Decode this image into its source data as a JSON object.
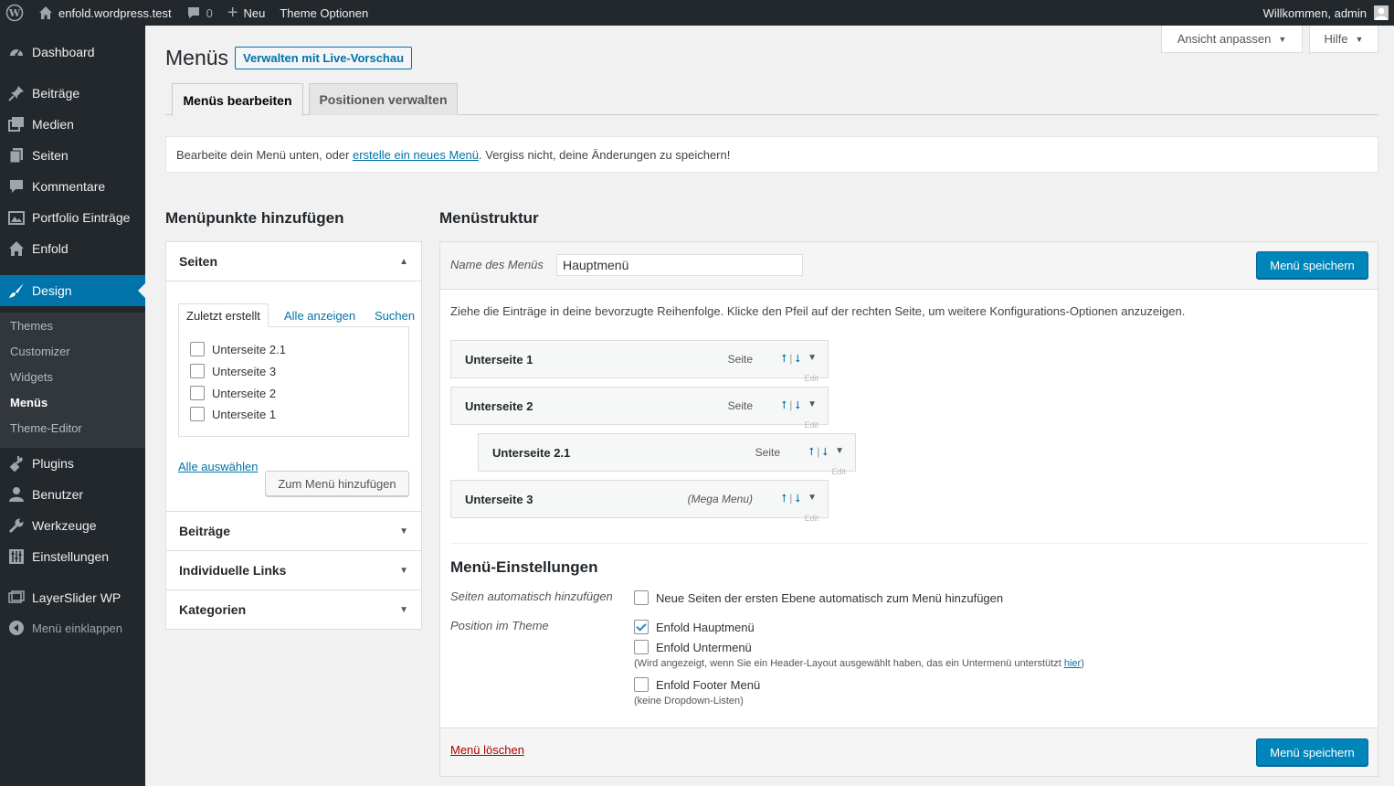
{
  "adminbar": {
    "site_name": "enfold.wordpress.test",
    "comments_count": "0",
    "new_label": "Neu",
    "theme_options": "Theme Optionen",
    "welcome": "Willkommen, admin"
  },
  "sidebar": {
    "items": [
      {
        "label": "Dashboard",
        "icon": "dashboard-icon"
      },
      {
        "label": "Beiträge",
        "icon": "pin-icon"
      },
      {
        "label": "Medien",
        "icon": "media-icon"
      },
      {
        "label": "Seiten",
        "icon": "pages-icon"
      },
      {
        "label": "Kommentare",
        "icon": "comment-icon"
      },
      {
        "label": "Portfolio Einträge",
        "icon": "portfolio-icon"
      },
      {
        "label": "Enfold",
        "icon": "home-icon"
      },
      {
        "label": "Design",
        "icon": "brush-icon"
      },
      {
        "label": "Plugins",
        "icon": "plugin-icon"
      },
      {
        "label": "Benutzer",
        "icon": "user-icon"
      },
      {
        "label": "Werkzeuge",
        "icon": "wrench-icon"
      },
      {
        "label": "Einstellungen",
        "icon": "settings-icon"
      },
      {
        "label": "LayerSlider WP",
        "icon": "layerslider-icon"
      },
      {
        "label": "Menü einklappen",
        "icon": "collapse-icon"
      }
    ],
    "submenu": [
      "Themes",
      "Customizer",
      "Widgets",
      "Menüs",
      "Theme-Editor"
    ]
  },
  "screen_meta": {
    "options": "Ansicht anpassen",
    "help": "Hilfe"
  },
  "header": {
    "title": "Menüs",
    "live_preview": "Verwalten mit Live-Vorschau"
  },
  "tabs": [
    "Menüs bearbeiten",
    "Positionen verwalten"
  ],
  "notice": {
    "before": "Bearbeite dein Menü unten, oder ",
    "link": "erstelle ein neues Menü",
    "after": ". Vergiss nicht, deine Änderungen zu speichern!"
  },
  "left": {
    "title": "Menüpunkte hinzufügen",
    "sections": [
      "Seiten",
      "Beiträge",
      "Individuelle Links",
      "Kategorien"
    ],
    "inner_tabs": [
      "Zuletzt erstellt",
      "Alle anzeigen",
      "Suchen"
    ],
    "pages": [
      "Unterseite 2.1",
      "Unterseite 3",
      "Unterseite 2",
      "Unterseite 1"
    ],
    "select_all": "Alle auswählen",
    "add_button": "Zum Menü hinzufügen"
  },
  "right": {
    "title": "Menüstruktur",
    "name_label": "Name des Menüs",
    "name_value": "Hauptmenü",
    "save": "Menü speichern",
    "instructions": "Ziehe die Einträge in deine bevorzugte Reihenfolge. Klicke den Pfeil auf der rechten Seite, um weitere Konfigurations-Optionen anzuzeigen.",
    "items": [
      {
        "title": "Unterseite 1",
        "type": "Seite",
        "edit": "Edit"
      },
      {
        "title": "Unterseite 2",
        "type": "Seite",
        "edit": "Edit"
      },
      {
        "title": "Unterseite 2.1",
        "type": "Seite",
        "edit": "Edit"
      },
      {
        "title": "Unterseite 3",
        "type": "(Mega Menu)",
        "edit": "Edit"
      }
    ],
    "settings_title": "Menü-Einstellungen",
    "auto_add_label": "Seiten automatisch hinzufügen",
    "auto_add_option": "Neue Seiten der ersten Ebene automatisch zum Menü hinzufügen",
    "position_label": "Position im Theme",
    "locations": [
      {
        "label": "Enfold Hauptmenü",
        "checked": true
      },
      {
        "label": "Enfold Untermenü",
        "checked": false
      },
      {
        "label": "Enfold Footer Menü",
        "checked": false
      }
    ],
    "submenu_note_before": "(Wird angezeigt, wenn Sie ein Header-Layout ausgewählt haben, das ein Untermenü unterstützt ",
    "submenu_note_link": "hier",
    "submenu_note_after": ")",
    "footer_note": "(keine Dropdown-Listen)",
    "delete": "Menü löschen"
  },
  "colors": {
    "accent": "#0073aa",
    "primary_button": "#0085ba",
    "adminbar": "#23282d",
    "delete": "#aa0000"
  }
}
